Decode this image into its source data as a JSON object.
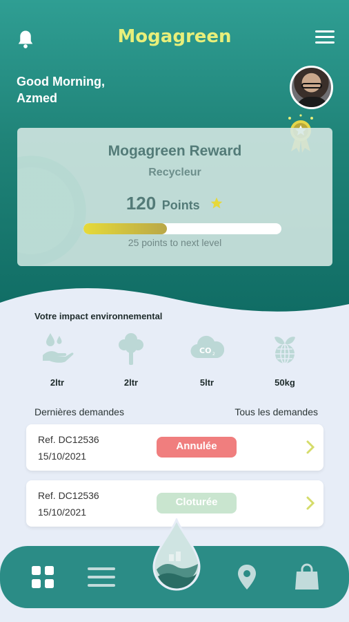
{
  "header": {
    "app_title": "Mogagreen",
    "bell_icon": "bell-icon",
    "menu_icon": "hamburger-menu-icon"
  },
  "greeting": {
    "line1": "Good Morning,",
    "line2": "Azmed"
  },
  "colors": {
    "brand_teal": "#1f8277",
    "title_yellow": "#e8ef7a",
    "cancelled": "#f07e7e",
    "closed": "#c9e5cf",
    "nav_bg": "#2b8c86"
  },
  "reward": {
    "title": "Mogagreen Reward",
    "level": "Recycleur",
    "points_value": "120",
    "points_label": "Points",
    "progress_fraction": 0.42,
    "next_level_text": "25 points to next level"
  },
  "impact": {
    "title": "Votre impact environnemental",
    "items": [
      {
        "icon": "water-hand-icon",
        "value": "2ltr"
      },
      {
        "icon": "tree-icon",
        "value": "2ltr"
      },
      {
        "icon": "co2-cloud-icon",
        "value": "5ltr"
      },
      {
        "icon": "globe-plant-icon",
        "value": "50kg"
      }
    ]
  },
  "requests": {
    "section_title": "Dernières demandes",
    "see_all": "Tous les demandes",
    "items": [
      {
        "ref": "Ref. DC12536",
        "date": "15/10/2021",
        "status": "Annulée",
        "status_color": "#f07e7e"
      },
      {
        "ref": "Ref. DC12536",
        "date": "15/10/2021",
        "status": "Cloturée",
        "status_color": "#c9e5cf"
      }
    ]
  },
  "navbar": {
    "items": [
      "dashboard-grid-icon",
      "list-icon",
      "water-drop-logo",
      "location-pin-icon",
      "shopping-bag-icon"
    ]
  }
}
